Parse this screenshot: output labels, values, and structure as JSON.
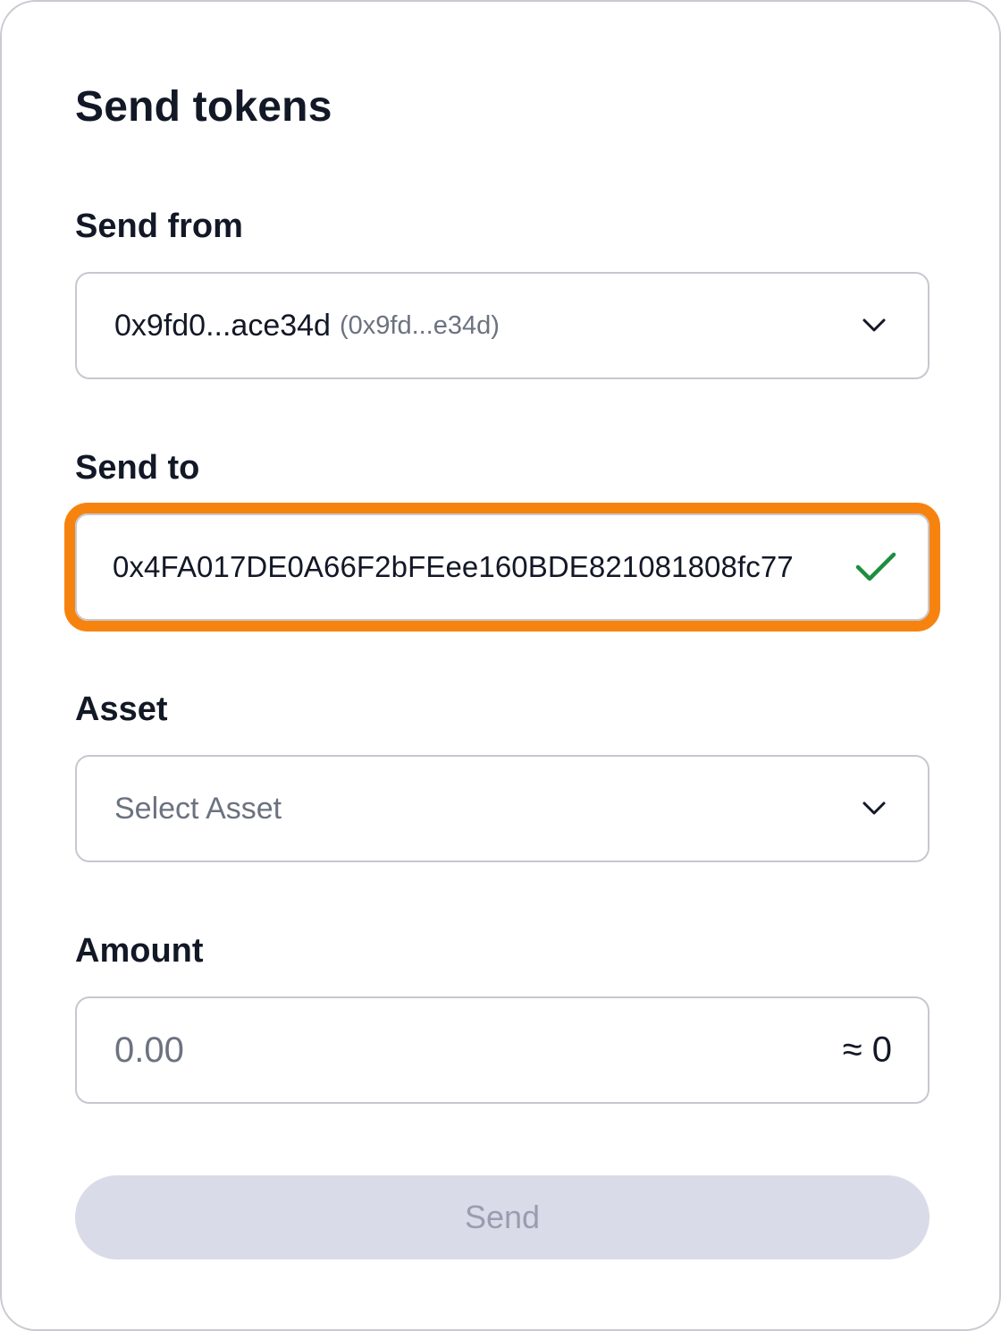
{
  "header": {
    "title": "Send tokens"
  },
  "send_from": {
    "label": "Send from",
    "value": "0x9fd0...ace34d",
    "sub_value": "(0x9fd...e34d)"
  },
  "send_to": {
    "label": "Send to",
    "value": "0x4FA017DE0A66F2bFEee160BDE821081808fc77",
    "status": "valid"
  },
  "asset": {
    "label": "Asset",
    "placeholder": "Select Asset"
  },
  "amount": {
    "label": "Amount",
    "placeholder": "0.00",
    "approx": "≈ 0"
  },
  "actions": {
    "send_label": "Send",
    "send_enabled": false
  },
  "colors": {
    "highlight": "#f7830f",
    "check": "#1e8e3e",
    "button_disabled_bg": "#d9dbe8",
    "button_disabled_text": "#9a9db0"
  },
  "icons": {
    "dropdown": "chevron-down-icon",
    "valid": "checkmark-icon"
  }
}
